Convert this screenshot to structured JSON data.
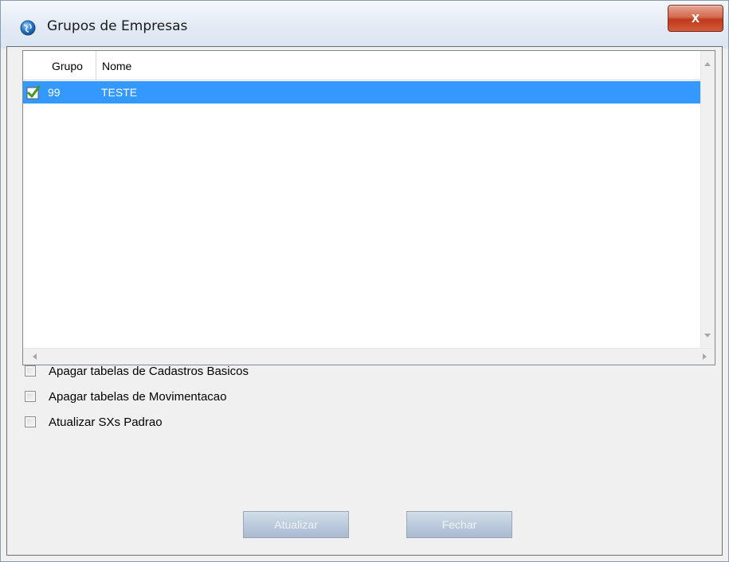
{
  "window": {
    "title": "Grupos de Empresas",
    "close_glyph": "x"
  },
  "grid": {
    "columns": [
      "Grupo",
      "Nome"
    ],
    "rows": [
      {
        "grupo": "99",
        "nome": "TESTE",
        "checked": true,
        "selected": true
      }
    ]
  },
  "options": [
    {
      "label": "Apagar tabelas de Cadastros Basicos",
      "checked": false
    },
    {
      "label": "Apagar tabelas de Movimentacao",
      "checked": false
    },
    {
      "label": "Atualizar SXs Padrao",
      "checked": false
    }
  ],
  "buttons": {
    "update_label": "Atualizar",
    "close_label": "Fechar"
  },
  "colors": {
    "selection": "#3399ff",
    "check_green": "#3d9a1f"
  },
  "icons": {
    "title": "app-globe-icon",
    "row_check": "green-checkmark-icon"
  }
}
